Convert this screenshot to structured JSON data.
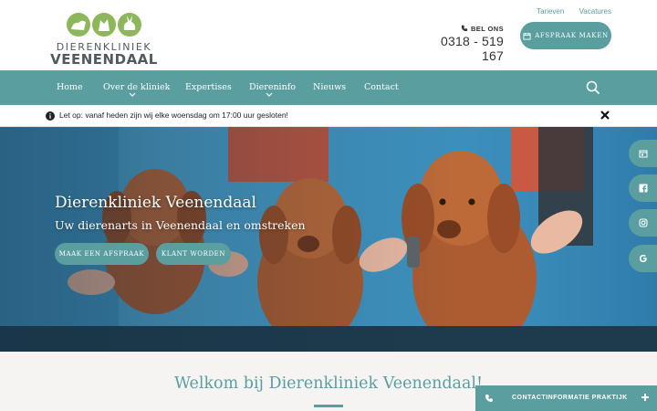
{
  "logo": {
    "line1": "DIERENKLINIEK",
    "line2": "VEENENDAAL",
    "colors": [
      "#8db75a",
      "#8db75a",
      "#8db75a"
    ]
  },
  "toplinks": {
    "tarieven": "Tarieven",
    "vacatures": "Vacatures"
  },
  "call": {
    "label": "BEL ONS",
    "number": "0318 - 519 167"
  },
  "appointment_button": "AFSPRAAK MAKEN",
  "nav": {
    "items": [
      "Home",
      "Over de kliniek",
      "Expertises",
      "Diereninfo",
      "Nieuws",
      "Contact"
    ],
    "dropdown_items": [
      "Over de kliniek",
      "Diereninfo"
    ]
  },
  "notice": {
    "text": "Let op: vanaf heden zijn wij elke woensdag om 17:00 uur gesloten!"
  },
  "hero": {
    "title": "Dierenkliniek Veenendaal",
    "subtitle": "Uw dierenarts in Veenendaal en omstreken",
    "button_primary": "MAAK EEN AFSPRAAK",
    "button_secondary": "KLANT WORDEN"
  },
  "side_tabs": [
    "calendar-icon",
    "facebook-icon",
    "instagram-icon",
    "google-icon"
  ],
  "welcome": {
    "title": "Welkom bij Dierenkliniek Veenendaal!"
  },
  "contact_bar": {
    "label": "CONTACTINFORMATIE PRAKTIJK"
  },
  "colors": {
    "accent": "#5a9ea0",
    "logo_green": "#8db75a",
    "text_dark": "#2d3436"
  }
}
